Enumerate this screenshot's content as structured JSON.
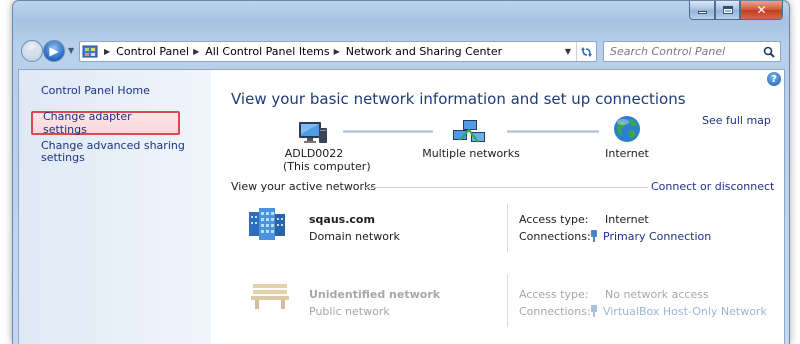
{
  "window": {
    "caption": {
      "minimize_label": "",
      "maximize_label": "",
      "close_label": "✕"
    }
  },
  "nav": {
    "back_glyph": "◀",
    "forward_glyph": "▶",
    "breadcrumbs": [
      "Control Panel",
      "All Control Panel Items",
      "Network and Sharing Center"
    ],
    "search_placeholder": "Search Control Panel"
  },
  "sidebar": {
    "home": "Control Panel Home",
    "items": [
      {
        "label": "Change adapter settings",
        "highlighted": true
      },
      {
        "label": "Change advanced sharing settings",
        "highlighted": false
      }
    ]
  },
  "main": {
    "title": "View your basic network information and set up connections",
    "see_full_map": "See full map",
    "map": {
      "computer_name": "ADLD0022",
      "computer_sub": "(This computer)",
      "network": "Multiple networks",
      "internet": "Internet"
    },
    "active_label": "View your active networks",
    "connect_link": "Connect or disconnect",
    "networks": [
      {
        "name": "sqaus.com",
        "category": "Domain network",
        "access_key": "Access type:",
        "access_val": "Internet",
        "conn_key": "Connections:",
        "conn_val": "Primary Connection",
        "enabled": true,
        "icon": "domain-network-icon"
      },
      {
        "name": "Unidentified network",
        "category": "Public network",
        "access_key": "Access type:",
        "access_val": "No network access",
        "conn_key": "Connections:",
        "conn_val": "VirtualBox Host-Only Network",
        "enabled": false,
        "icon": "public-network-bench-icon"
      }
    ]
  },
  "colors": {
    "link": "#1e3287",
    "highlight_border": "#e04650",
    "title": "#1e3c78"
  }
}
